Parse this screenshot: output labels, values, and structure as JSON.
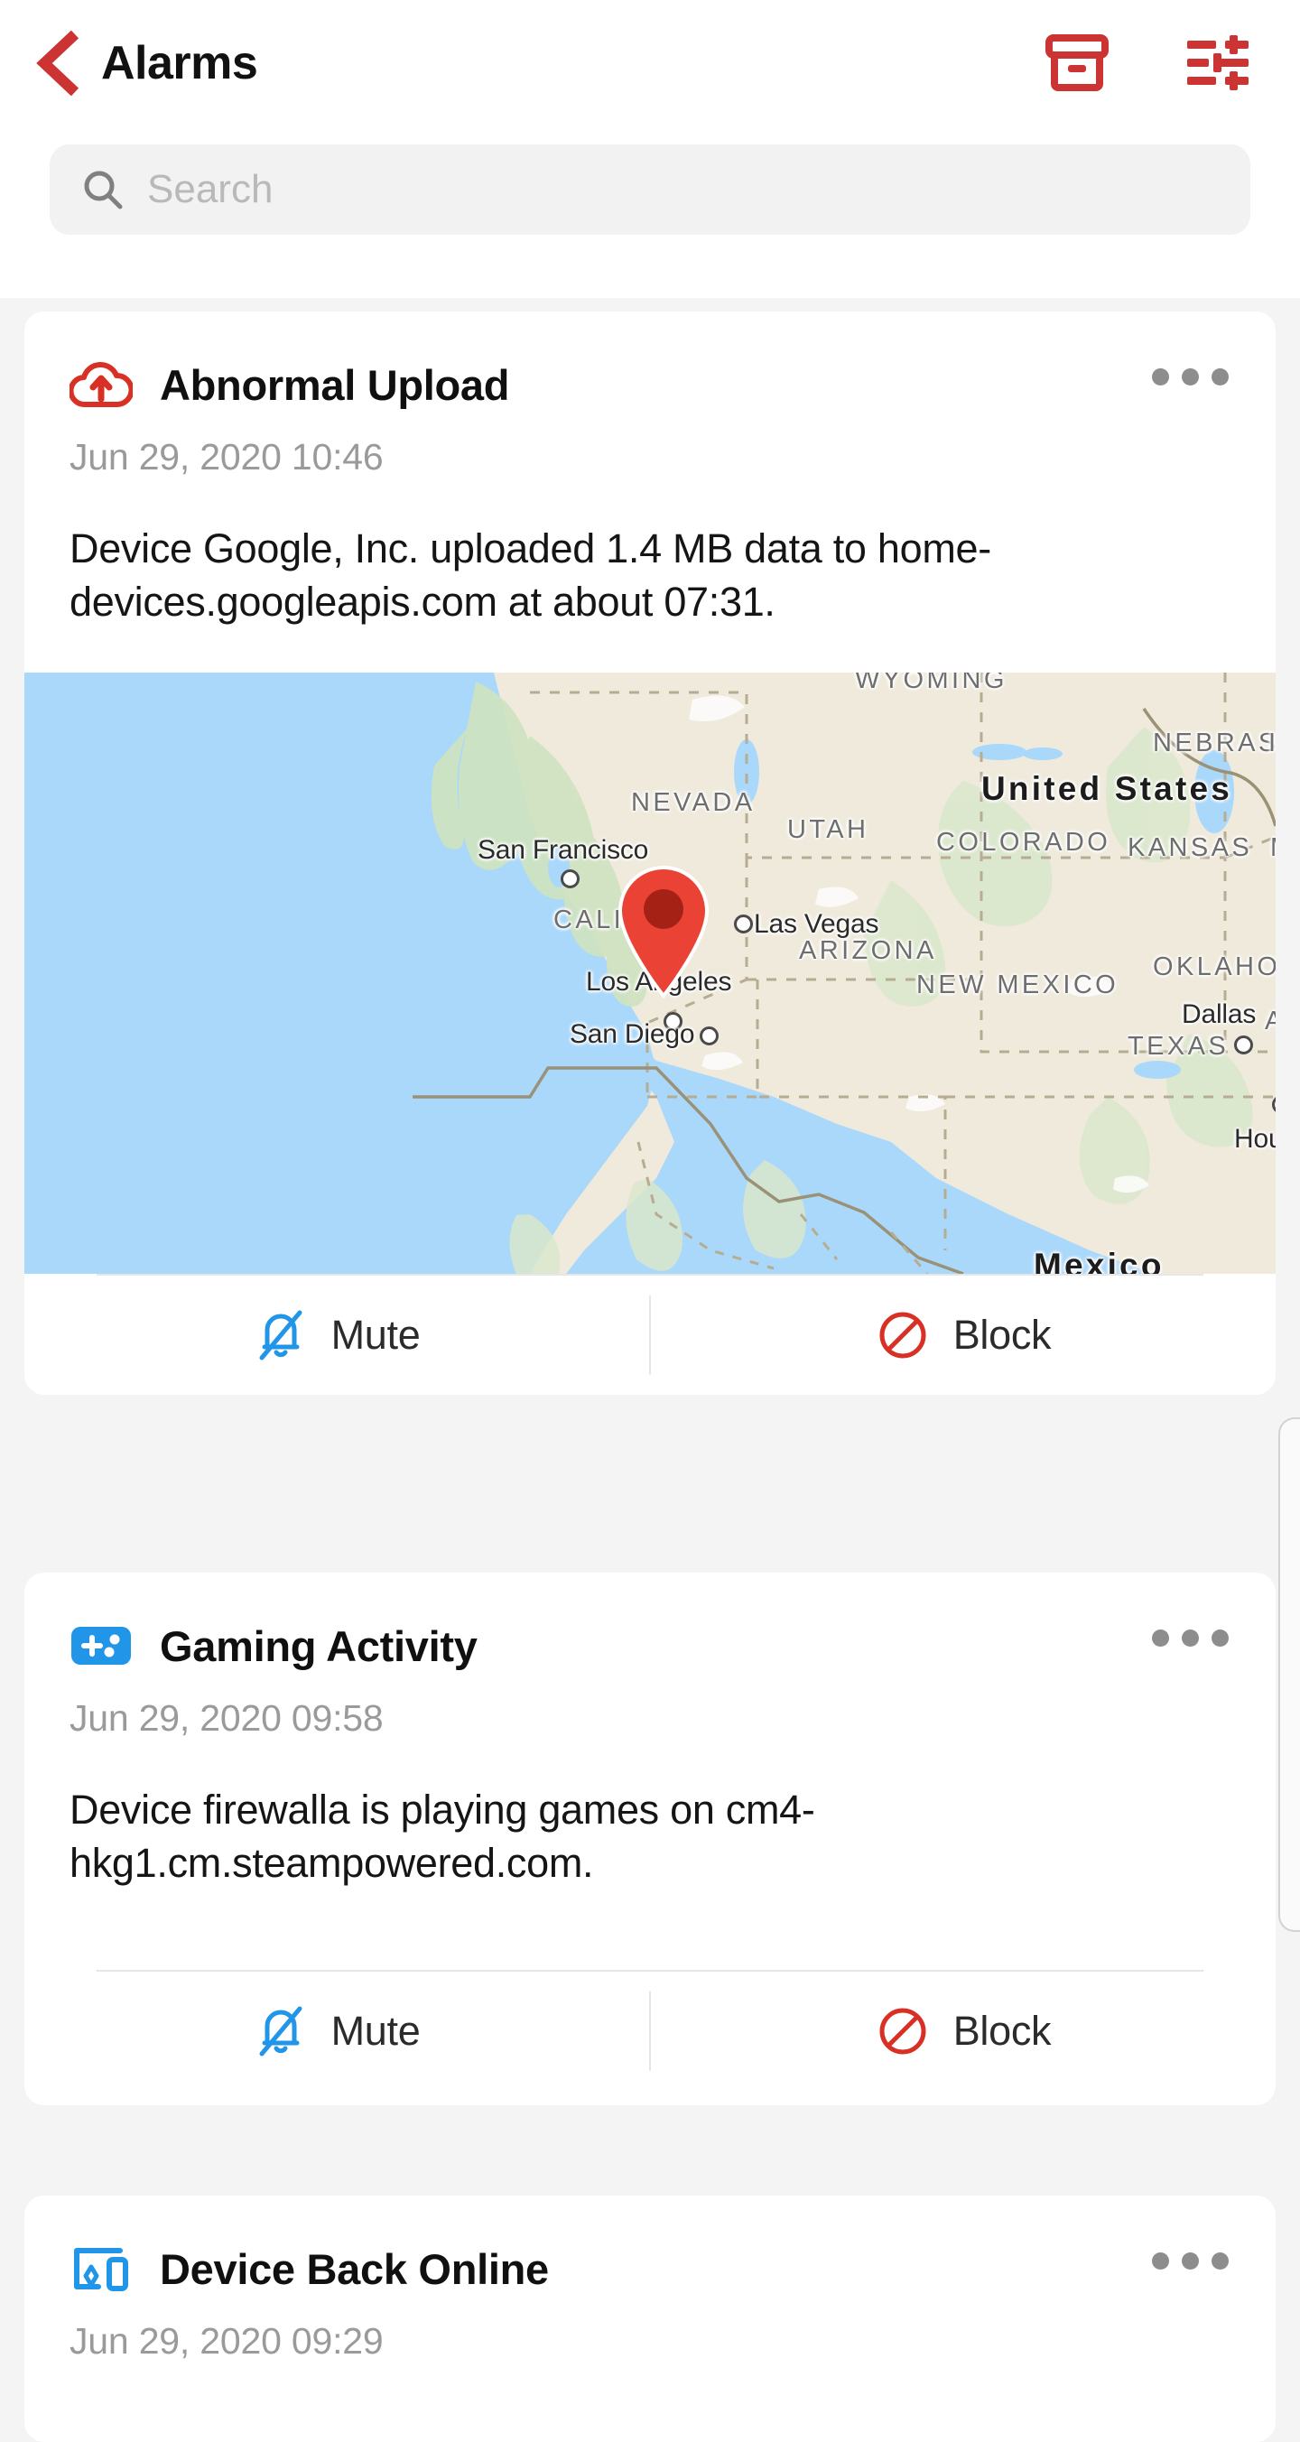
{
  "header": {
    "back_icon": "chevron-left-icon",
    "title": "Alarms",
    "archive_icon": "archive-box-icon",
    "filter_icon": "filter-sliders-icon",
    "accent_color": "#CC3333"
  },
  "search": {
    "icon": "search-icon",
    "placeholder": "Search",
    "value": ""
  },
  "alarms": [
    {
      "icon": "cloud-upload-icon",
      "icon_color": "#D93025",
      "title": "Abnormal Upload",
      "timestamp": "Jun 29, 2020 10:46",
      "body": "Device Google, Inc. uploaded 1.4 MB data to home-devices.googleapis.com at about 07:31.",
      "menu_icon": "more-options-icon",
      "has_map": true,
      "actions": [
        {
          "icon": "bell-slash-icon",
          "label": "Mute",
          "color": "#2196E8"
        },
        {
          "icon": "block-circle-icon",
          "label": "Block",
          "color": "#D93025"
        }
      ]
    },
    {
      "icon": "gamepad-icon",
      "icon_color": "#2196E8",
      "title": "Gaming Activity",
      "timestamp": "Jun 29, 2020 09:58",
      "body": "Device firewalla is playing games on cm4-hkg1.cm.steampowered.com.",
      "menu_icon": "more-options-icon",
      "has_map": false,
      "actions": [
        {
          "icon": "bell-slash-icon",
          "label": "Mute",
          "color": "#2196E8"
        },
        {
          "icon": "block-circle-icon",
          "label": "Block",
          "color": "#D93025"
        }
      ]
    },
    {
      "icon": "device-monitor-icon",
      "icon_color": "#2196E8",
      "title": "Device Back Online",
      "timestamp": "Jun 29, 2020 09:29",
      "menu_icon": "more-options-icon",
      "has_map": false
    }
  ],
  "map": {
    "ocean_color": "#AAD8FB",
    "land_color": "#F0EADC",
    "states": [
      "NEVADA",
      "UTAH",
      "COLORADO",
      "KANSAS",
      "NEBRASKA",
      "WYOMING",
      "OKLAHOMA",
      "ARIZONA",
      "NEW MEXICO",
      "TEXAS",
      "CALIFO"
    ],
    "country_label": "United States",
    "country_label_2": "Mexico",
    "cities": [
      "San Francisco",
      "Las Vegas",
      "Los Angeles",
      "San Diego",
      "Dallas",
      "Houst"
    ],
    "pin": {
      "label": "Los Angeles",
      "color": "#EA4335"
    }
  }
}
